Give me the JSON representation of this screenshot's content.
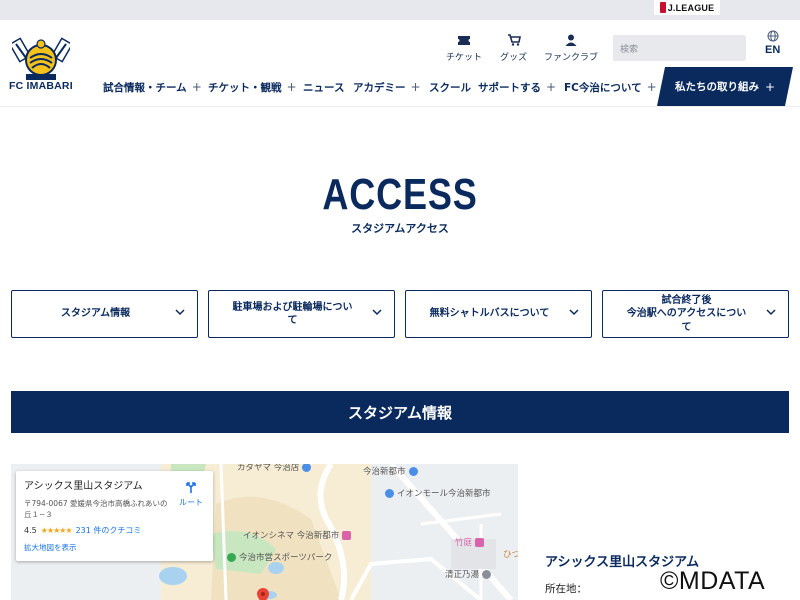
{
  "brand": {
    "league_badge": "J.LEAGUE",
    "club_name": "FC IMABARI"
  },
  "utility": {
    "ticket": "チケット",
    "goods": "グッズ",
    "fanclub": "ファンクラブ",
    "search_placeholder": "検索",
    "language": "EN"
  },
  "nav": {
    "items": [
      {
        "label": "試合情報・チーム",
        "plus": "+"
      },
      {
        "label": "チケット・観戦",
        "plus": "+"
      },
      {
        "label": "ニュース",
        "plus": ""
      },
      {
        "label": "アカデミー",
        "plus": "+"
      },
      {
        "label": "スクール",
        "plus": ""
      },
      {
        "label": "サポートする",
        "plus": "+"
      },
      {
        "label": "FC今治について",
        "plus": "+"
      }
    ],
    "cta": {
      "label": "私たちの取り組み",
      "plus": "+"
    }
  },
  "hero": {
    "title": "ACCESS",
    "subtitle": "スタジアムアクセス"
  },
  "anchors": [
    {
      "label": "スタジアム情報"
    },
    {
      "label": "駐車場および駐輪場につい\nて"
    },
    {
      "label": "無料シャトルバスについて"
    },
    {
      "label": "試合終了後\n今治駅へのアクセスについ\nて"
    }
  ],
  "section": {
    "title": "スタジアム情報"
  },
  "map": {
    "card": {
      "name": "アシックス里山スタジアム",
      "address": "〒794-0067 愛媛県今治市高橋ふれあいの丘１−３",
      "rating": "4.5",
      "stars": "★★★★★",
      "reviews": "231 件のクチコミ",
      "enlarge": "拡大地図を表示",
      "route": "ルート"
    },
    "pois": {
      "kagayama": "カダヤマ 今治店",
      "imabari_shintoshi": "今治新都市",
      "aeon_mall": "イオンモール今治新都市",
      "aeon_cinema": "イオンシネマ 今治新都市",
      "sports_park": "今治市営スポーツパーク",
      "takenoniwa": "竹庭",
      "hyo": "ひつ",
      "kiyomasa": "清正乃湯"
    },
    "colors": {
      "pin": "#ea4335",
      "blue_poi": "#4a8ee8",
      "green_poi": "#34a853",
      "pink_poi": "#d863a8",
      "water": "#a9d2f0",
      "park": "#c8e6c0"
    }
  },
  "venue": {
    "name": "アシックス里山スタジアム",
    "location_label": "所在地："
  },
  "watermark": "©MDATA",
  "colors": {
    "navy": "#0a2a5e",
    "topbar": "#e6e8ee"
  }
}
